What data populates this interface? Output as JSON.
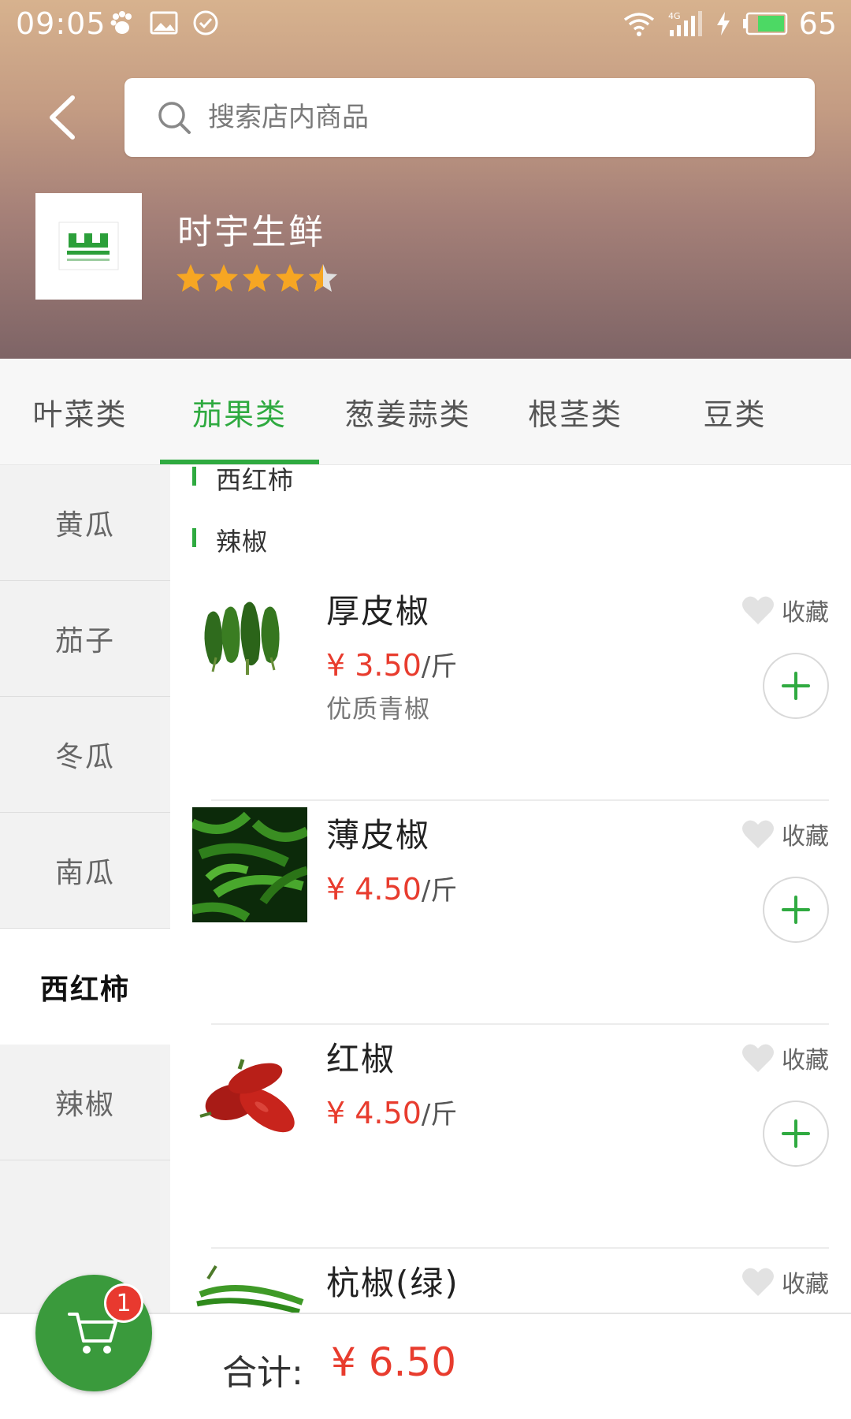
{
  "status_bar": {
    "time": "09:05",
    "battery": "65",
    "icons": [
      "baidu-paw-icon",
      "image-icon",
      "check-circle-icon",
      "wifi-icon",
      "signal-4g-icon",
      "charging-icon",
      "battery-icon"
    ]
  },
  "header": {
    "back_icon": "chevron-left-icon",
    "search_placeholder": "搜索店内商品",
    "shop_name": "时宇生鲜",
    "logo_text": "W",
    "rating": 4.5
  },
  "tabs": [
    {
      "label": "叶菜类",
      "active": false
    },
    {
      "label": "茄果类",
      "active": true
    },
    {
      "label": "葱姜蒜类",
      "active": false
    },
    {
      "label": "根茎类",
      "active": false
    },
    {
      "label": "豆类",
      "active": false
    }
  ],
  "sidebar": [
    {
      "label": "黄瓜",
      "active": false
    },
    {
      "label": "茄子",
      "active": false
    },
    {
      "label": "冬瓜",
      "active": false
    },
    {
      "label": "南瓜",
      "active": false
    },
    {
      "label": "西红柿",
      "active": true
    },
    {
      "label": "辣椒",
      "active": false
    }
  ],
  "content": {
    "sections": [
      "西红柿",
      "辣椒"
    ],
    "favorite_label": "收藏",
    "products": [
      {
        "name": "厚皮椒",
        "price": "¥ 3.50",
        "unit": "/斤",
        "desc": "优质青椒",
        "image": "thick-pepper"
      },
      {
        "name": "薄皮椒",
        "price": "¥ 4.50",
        "unit": "/斤",
        "desc": "",
        "image": "thin-pepper"
      },
      {
        "name": "红椒",
        "price": "¥ 4.50",
        "unit": "/斤",
        "desc": "",
        "image": "red-pepper"
      },
      {
        "name": "杭椒(绿)",
        "price": "",
        "unit": "",
        "desc": "",
        "image": "hang-pepper"
      }
    ]
  },
  "footer": {
    "total_label": "合计:",
    "total_value": "¥ 6.50",
    "cart_count": "1"
  },
  "colors": {
    "accent": "#2faa40",
    "price": "#e83c2e",
    "cart": "#3a9a3c",
    "badge": "#e8392f",
    "star": "#f6a623"
  }
}
